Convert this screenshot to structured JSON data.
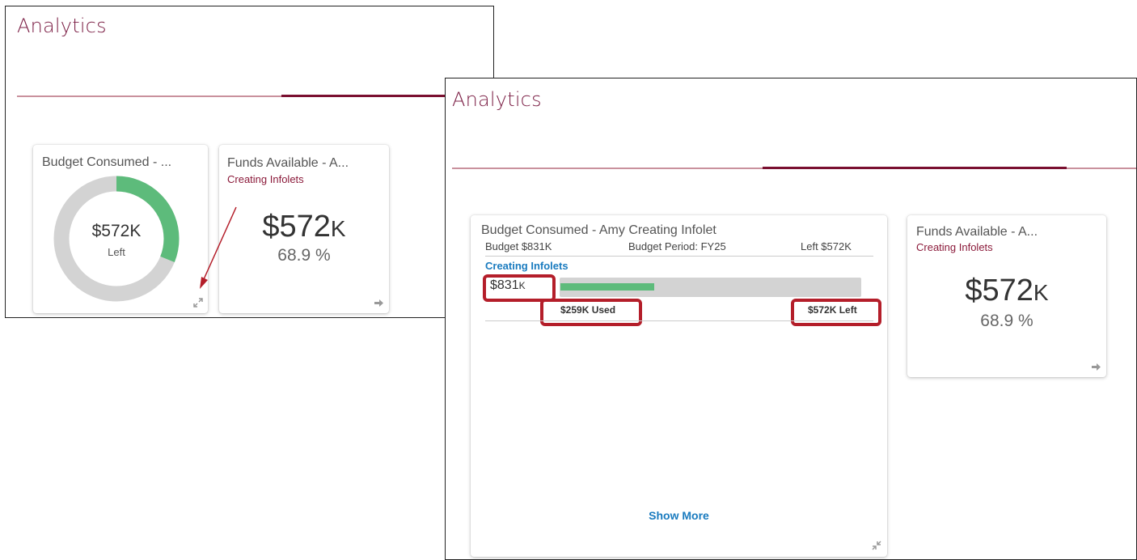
{
  "small_panel": {
    "title": "Analytics",
    "budget_card": {
      "title": "Budget Consumed - ...",
      "amount": "$572K",
      "label": "Left",
      "consumed_fraction": 0.311
    },
    "funds_card": {
      "title": "Funds Available - A...",
      "subtitle": "Creating Infolets",
      "amount_main": "$572",
      "amount_suffix": "K",
      "percent": "68.9 %"
    }
  },
  "large_panel": {
    "title": "Analytics",
    "budget_card": {
      "title": "Budget Consumed - Amy Creating Infolet",
      "budget": "Budget $831K",
      "period": "Budget Period: FY25",
      "left": "Left $572K",
      "link": "Creating Infolets",
      "total_main": "$831",
      "total_suffix": "K",
      "used": "$259K Used",
      "remaining": "$572K Left",
      "used_fraction": 0.311,
      "show_more": "Show More"
    },
    "funds_card": {
      "title": "Funds Available - A...",
      "subtitle": "Creating Infolets",
      "amount_main": "$572",
      "amount_suffix": "K",
      "percent": "68.9 %"
    }
  },
  "colors": {
    "accent": "#7d2147",
    "rule_dark": "#7a1030",
    "rule_light": "#c9919d",
    "donut_fill": "#5dbb7b",
    "donut_track": "#d3d3d3",
    "highlight": "#b41e2a",
    "link": "#1a7bbf"
  },
  "icons": {
    "expand": "expand-icon",
    "collapse": "collapse-icon",
    "navigate": "arrow-right-icon"
  }
}
